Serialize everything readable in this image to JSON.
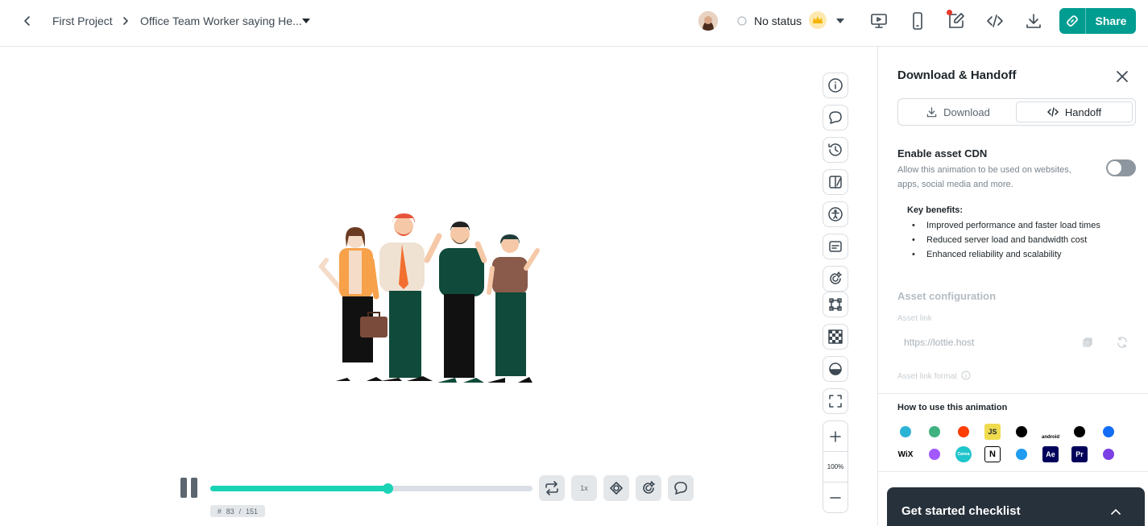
{
  "header": {
    "breadcrumb_project": "First Project",
    "breadcrumb_file": "Office Team Worker saying He...",
    "status_label": "No status",
    "share_label": "Share"
  },
  "player": {
    "progress_fraction": 0.5497,
    "frame_hash": "#",
    "frame_current": "83",
    "frame_sep": "/",
    "frame_total": "151",
    "speed_label": "1x"
  },
  "zoom": {
    "level": "100%"
  },
  "panel": {
    "title": "Download & Handoff",
    "tab_download": "Download",
    "tab_handoff": "Handoff",
    "cdn_title": "Enable asset CDN",
    "cdn_desc": "Allow this animation to be used on websites, apps, social media and more.",
    "benefits_title": "Key benefits:",
    "benefits": [
      "Improved performance and faster load times",
      "Reduced server load and bandwidth cost",
      "Enhanced reliability and scalability"
    ],
    "config_title": "Asset configuration",
    "asset_link_label": "Asset link",
    "asset_link_value": "https://lottie.host",
    "asset_link_format_label": "Asset link format",
    "how_title": "How to use this animation",
    "frameworks": [
      {
        "name": "react-icon",
        "label": "",
        "color": "#2bb3d6"
      },
      {
        "name": "vue-icon",
        "label": "",
        "color": "#3fb27f"
      },
      {
        "name": "svelte-icon",
        "label": "",
        "color": "#ff3e00"
      },
      {
        "name": "js-icon",
        "label": "JS",
        "color": "#f0db4f"
      },
      {
        "name": "apple-icon",
        "label": "",
        "color": "#000000"
      },
      {
        "name": "android-icon",
        "label": "android",
        "color": "#3ddc84"
      },
      {
        "name": "framer-icon",
        "label": "",
        "color": "#000000"
      },
      {
        "name": "webflow-icon",
        "label": "",
        "color": "#146ef5"
      },
      {
        "name": "wix-icon",
        "label": "WiX",
        "color": "#000000"
      },
      {
        "name": "figma-icon",
        "label": "",
        "color": "#a259ff"
      },
      {
        "name": "canva-icon",
        "label": "Canva",
        "color": "#20c4cb"
      },
      {
        "name": "notion-icon",
        "label": "N",
        "color": "#000000"
      },
      {
        "name": "keynote-icon",
        "label": "",
        "color": "#1f9cf0"
      },
      {
        "name": "after-effects-icon",
        "label": "Ae",
        "color": "#00005b"
      },
      {
        "name": "premiere-icon",
        "label": "Pr",
        "color": "#00005b"
      },
      {
        "name": "final-cut-icon",
        "label": "",
        "color": "#7b3fe4"
      }
    ],
    "checklist_title": "Get started checklist"
  }
}
